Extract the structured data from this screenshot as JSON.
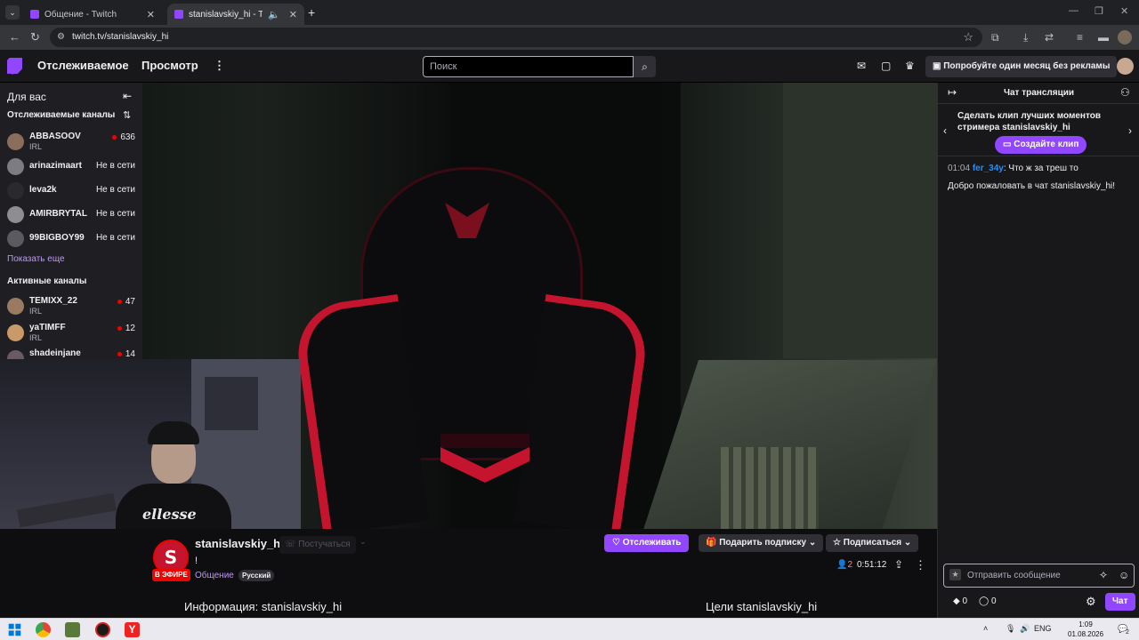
{
  "browser": {
    "tabs": [
      {
        "title": "Общение - Twitch"
      },
      {
        "title": "stanislavskiy_hi - Twitch"
      }
    ],
    "url": "twitch.tv/stanislavskiy_hi"
  },
  "topnav": {
    "following": "Отслеживаемое",
    "browse": "Просмотр",
    "search_placeholder": "Поиск",
    "promo": "Попробуйте один месяц без рекламы"
  },
  "sidebar": {
    "title": "Для вас",
    "followed_header": "Отслеживаемые каналы",
    "followed": [
      {
        "name": "ABBASOOV",
        "category": "IRL",
        "viewers": "636",
        "avatar_color": "#8a6d5a"
      },
      {
        "name": "arinazimaart",
        "status": "Не в сети",
        "avatar_color": "#7c7c82"
      },
      {
        "name": "leva2k",
        "status": "Не в сети",
        "avatar_color": "#2a2a2e"
      },
      {
        "name": "AMIRBRYTAL",
        "status": "Не в сети",
        "avatar_color": "#8d8d92"
      },
      {
        "name": "99BIGBOY99",
        "status": "Не в сети",
        "avatar_color": "#5a5a60"
      }
    ],
    "show_more": "Показать еще",
    "active_header": "Активные каналы",
    "active": [
      {
        "name": "TEMIXX_22",
        "category": "IRL",
        "viewers": "47",
        "avatar_color": "#9a7a62"
      },
      {
        "name": "yaTIMFF",
        "category": "IRL",
        "viewers": "12",
        "avatar_color": "#c89a6a"
      },
      {
        "name": "shadeinjane",
        "viewers": "14",
        "avatar_color": "#6a5a66"
      }
    ]
  },
  "webcam": {
    "shirt_brand": "ellesse"
  },
  "channel": {
    "avatar_letter": "S",
    "live_badge": "В ЭФИРЕ",
    "name": "stanislavskiy_hi",
    "knock": "Постучаться",
    "title": "!",
    "category": "Общение",
    "language": "Русский",
    "follow": "Отслеживать",
    "gift": "Подарить подписку",
    "subscribe": "Подписаться",
    "viewers": "2",
    "uptime": "0:51:12",
    "about": "Информация: stanislavskiy_hi",
    "goals": "Цели stanislavskiy_hi"
  },
  "chat": {
    "title": "Чат трансляции",
    "clip_promo": "Сделать клип лучших моментов стримера stanislavskiy_hi",
    "clip_button": "Создайте клип",
    "messages": [
      {
        "time": "01:04",
        "user": "fer_34y",
        "text": ": Что ж за треш то"
      }
    ],
    "welcome": "Добро пожаловать в чат stanislavskiy_hi!",
    "input_placeholder": "Отправить сообщение",
    "bits": "0",
    "points": "0",
    "chat_button": "Чат"
  },
  "taskbar": {
    "lang": "ENG",
    "time": "1:09",
    "date": "01.08.2026",
    "notifications": "2"
  },
  "colors": {
    "twitch_purple": "#9146ff",
    "live_red": "#eb0400"
  }
}
